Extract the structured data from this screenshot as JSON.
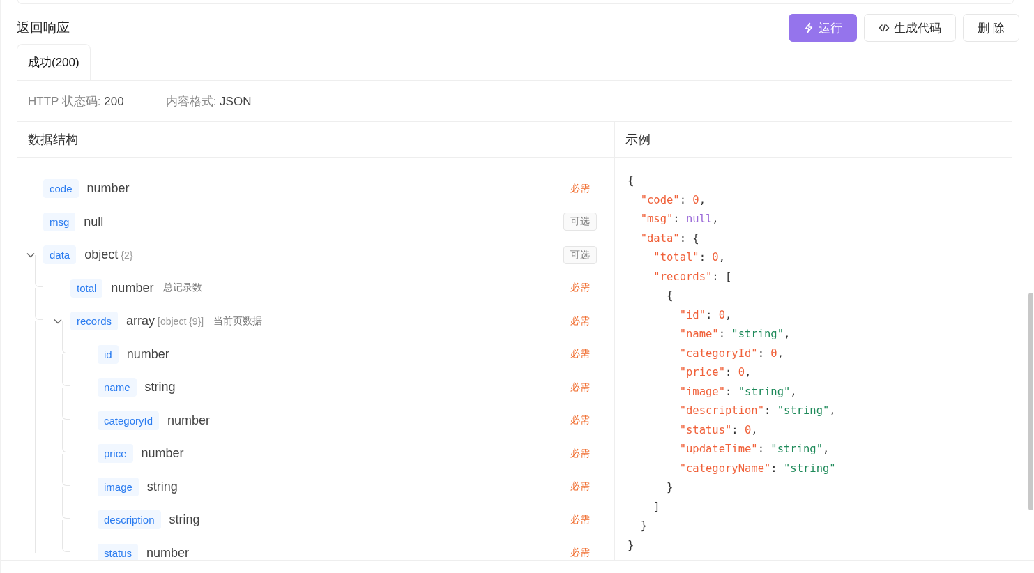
{
  "section_title": "返回响应",
  "buttons": [
    {
      "label": "运行",
      "kind": "primary"
    },
    {
      "label": "生成代码",
      "kind": "code"
    },
    {
      "label": "删 除",
      "kind": "plain"
    }
  ],
  "tabs": [
    {
      "label": "成功(200)",
      "selected": true
    }
  ],
  "meta": [
    {
      "label": "HTTP 状态码:",
      "value": "200"
    },
    {
      "label": "内容格式:",
      "value": "JSON"
    }
  ],
  "schema": {
    "title": "数据结构",
    "fields": [
      {
        "name": "code",
        "type": "number",
        "requirement": "必需",
        "kind": "required"
      },
      {
        "name": "msg",
        "type": "null",
        "requirement": "可选",
        "kind": "optional"
      },
      {
        "name": "data",
        "type": "object",
        "type_detail": "{2}",
        "requirement": "可选",
        "kind": "optional",
        "expanded": true,
        "children": [
          {
            "name": "total",
            "type": "number",
            "description": "总记录数",
            "requirement": "必需",
            "kind": "required"
          },
          {
            "name": "records",
            "type": "array",
            "type_detail": "[object {9}]",
            "description": "当前页数据",
            "requirement": "必需",
            "kind": "required",
            "expanded": true,
            "children": [
              {
                "name": "id",
                "type": "number",
                "requirement": "必需",
                "kind": "required"
              },
              {
                "name": "name",
                "type": "string",
                "requirement": "必需",
                "kind": "required"
              },
              {
                "name": "categoryId",
                "type": "number",
                "requirement": "必需",
                "kind": "required"
              },
              {
                "name": "price",
                "type": "number",
                "requirement": "必需",
                "kind": "required"
              },
              {
                "name": "image",
                "type": "string",
                "requirement": "必需",
                "kind": "required"
              },
              {
                "name": "description",
                "type": "string",
                "requirement": "必需",
                "kind": "required"
              },
              {
                "name": "status",
                "type": "number",
                "requirement": "必需",
                "kind": "required"
              }
            ]
          }
        ]
      }
    ]
  },
  "example": {
    "title": "示例",
    "lines": [
      "{",
      "  \"code\": 0,",
      "  \"msg\": null,",
      "  \"data\": {",
      "    \"total\": 0,",
      "    \"records\": [",
      "      {",
      "        \"id\": 0,",
      "        \"name\": \"string\",",
      "        \"categoryId\": 0,",
      "        \"price\": 0,",
      "        \"image\": \"string\",",
      "        \"description\": \"string\",",
      "        \"status\": 0,",
      "        \"updateTime\": \"string\",",
      "        \"categoryName\": \"string\"",
      "      }",
      "    ]",
      "  }",
      "}"
    ]
  }
}
